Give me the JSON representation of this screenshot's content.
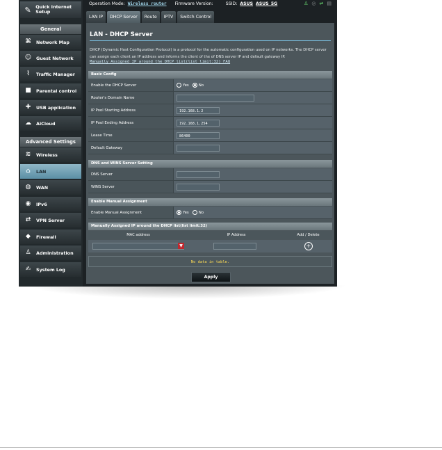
{
  "header": {
    "operation_mode_label": "Operation Mode:",
    "operation_mode_value": "Wireless router",
    "firmware_label": "Firmware Version:",
    "ssid_label": "SSID:",
    "ssid_1": "ASUS",
    "ssid_2": "ASUS_5G"
  },
  "sidebar": {
    "quick_setup": "Quick Internet Setup",
    "general_header": "General",
    "general_items": [
      {
        "label": "Network Map",
        "icon": "network-map-icon"
      },
      {
        "label": "Guest Network",
        "icon": "guest-network-icon"
      },
      {
        "label": "Traffic Manager",
        "icon": "traffic-manager-icon"
      },
      {
        "label": "Parental control",
        "icon": "lock-icon"
      },
      {
        "label": "USB application",
        "icon": "puzzle-icon"
      },
      {
        "label": "AiCloud",
        "icon": "cloud-icon"
      }
    ],
    "advanced_header": "Advanced Settings",
    "advanced_items": [
      {
        "label": "Wireless",
        "icon": "wifi-icon"
      },
      {
        "label": "LAN",
        "icon": "home-icon"
      },
      {
        "label": "WAN",
        "icon": "globe-icon"
      },
      {
        "label": "IPv6",
        "icon": "ipv6-icon"
      },
      {
        "label": "VPN Server",
        "icon": "vpn-icon"
      },
      {
        "label": "Firewall",
        "icon": "shield-icon"
      },
      {
        "label": "Administration",
        "icon": "admin-icon"
      },
      {
        "label": "System Log",
        "icon": "system-log-icon"
      }
    ],
    "active_item": "LAN"
  },
  "tabs": [
    "LAN IP",
    "DHCP Server",
    "Route",
    "IPTV",
    "Switch Control"
  ],
  "active_tab": "DHCP Server",
  "page": {
    "title": "LAN - DHCP Server",
    "description": "DHCP (Dynamic Host Configuration Protocol) is a protocol for the automatic configuration used on IP networks. The DHCP server can assign each client an IP address and informs the client of the of DNS server IP and default gateway IP.",
    "faq_link": "Manually Assigned IP around the DHCP list(list limit:32) FAQ"
  },
  "basic_config": {
    "header": "Basic Config",
    "enable_label": "Enable the DHCP Server",
    "yes": "Yes",
    "no": "No",
    "enable_value": "No",
    "domain_label": "Router's Domain Name",
    "domain_value": "",
    "start_label": "IP Pool Starting Address",
    "start_value": "192.168.1.2",
    "end_label": "IP Pool Ending Address",
    "end_value": "192.168.1.254",
    "lease_label": "Lease Time",
    "lease_value": "86400",
    "gateway_label": "Default Gateway",
    "gateway_value": ""
  },
  "dns_wins": {
    "header": "DNS and WINS Server Setting",
    "dns_label": "DNS Server",
    "dns_value": "",
    "wins_label": "WINS Server",
    "wins_value": ""
  },
  "manual": {
    "header": "Enable Manual Assignment",
    "label": "Enable Manual Assignment",
    "yes": "Yes",
    "no": "No",
    "value": "Yes"
  },
  "manual_list": {
    "header": "Manually Assigned IP around the DHCP list(list limit:32)",
    "col_mac": "MAC address",
    "col_ip": "IP Address",
    "col_action": "Add / Delete",
    "empty": "No data in table."
  },
  "apply_label": "Apply",
  "colors": {
    "accent_line": "#78b9d8",
    "active_sidebar": "#8fb7c7",
    "status_green": "#66d36e",
    "nodata_text": "#ffdd55"
  }
}
